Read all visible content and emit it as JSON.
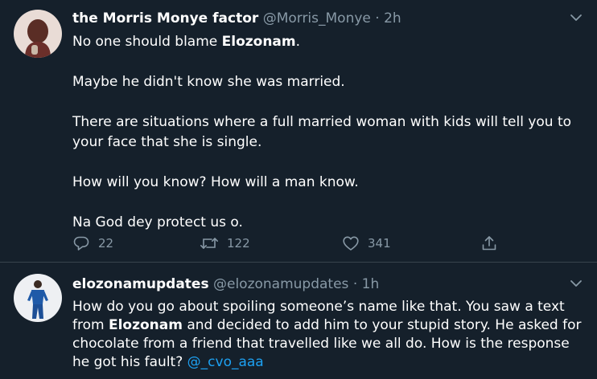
{
  "tweets": [
    {
      "display_name": "the Morris Monye factor",
      "handle": "@Morris_Monye",
      "dot": "·",
      "time": "2h",
      "paragraphs": [
        {
          "pre": "No one should blame ",
          "bold": "Elozonam",
          "post": "."
        },
        {
          "text": "Maybe he didn't know she was married."
        },
        {
          "text": "There are situations where a full married woman with kids will tell you to your face that she is single."
        },
        {
          "text": "How will you know? How will a man know."
        },
        {
          "text": "Na God dey protect us o."
        }
      ],
      "actions": {
        "replies": "22",
        "retweets": "122",
        "likes": "341"
      }
    },
    {
      "display_name": "elozonamupdates",
      "handle": "@elozonamupdates",
      "dot": "·",
      "time": "1h",
      "body": {
        "pre": "How do you go about spoiling someone’s name like that. You saw a text from ",
        "bold": "Elozonam",
        "post": " and decided to add him to your stupid story. He asked for chocolate from a friend that travelled like we all do. How is the response he got his fault? ",
        "mention": "@_cvo_aaa"
      }
    }
  ],
  "icons": {
    "chevron": "chevron-down-icon",
    "reply": "reply-icon",
    "retweet": "retweet-icon",
    "like": "heart-icon",
    "share": "share-icon"
  },
  "colors": {
    "background": "#15202b",
    "secondary_text": "#8899a6",
    "link": "#1da1f2",
    "divider": "#38444d"
  }
}
